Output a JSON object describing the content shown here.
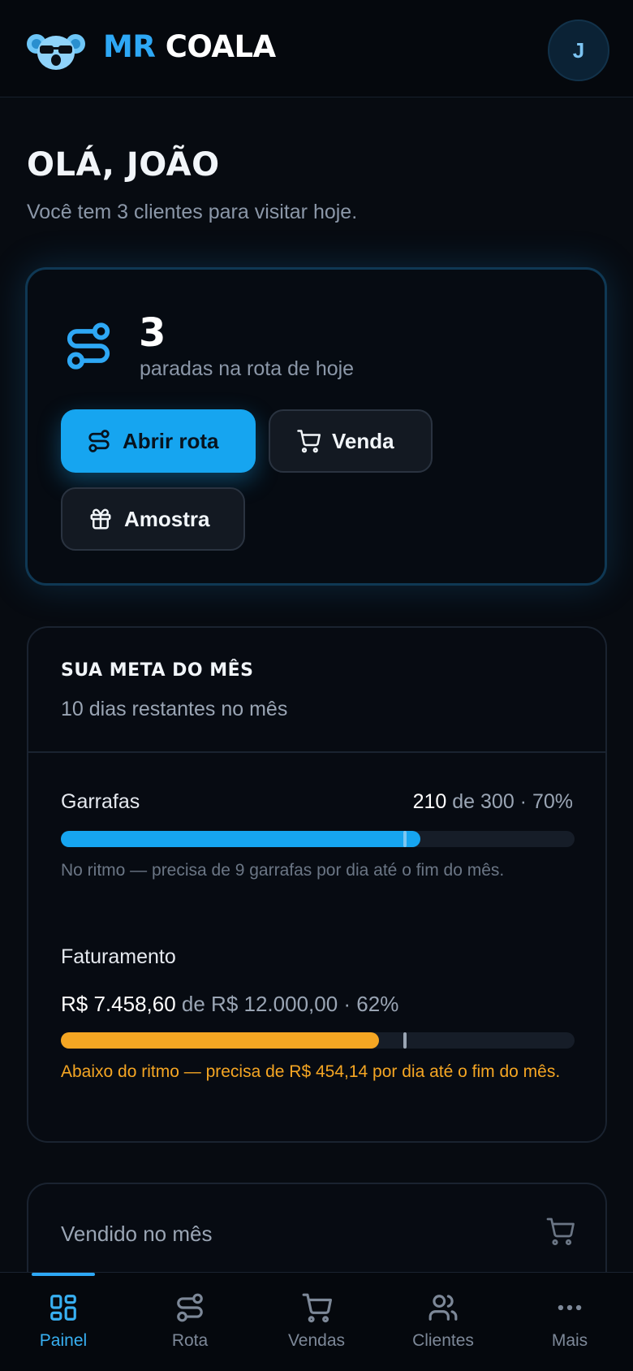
{
  "header": {
    "brand_part1": "MR",
    "brand_part2": "COALA",
    "avatar_initial": "J",
    "logo_icon": "koala-logo-icon"
  },
  "greeting": {
    "title": "OLÁ, JOÃO",
    "subtitle": "Você tem 3 clientes para visitar hoje."
  },
  "route_card": {
    "icon": "route-icon",
    "count": "3",
    "count_label": "paradas na rota de hoje",
    "buttons": {
      "open_route": "Abrir rota",
      "sale": "Venda",
      "sample": "Amostra"
    }
  },
  "goal_card": {
    "title": "SUA META DO MÊS",
    "subtitle": "10 dias restantes no mês",
    "bottles": {
      "label": "Garrafas",
      "current": "210",
      "of_total": " de 300 · 70%",
      "progress": 0.7,
      "expected_pace": 0.67,
      "note": "No ritmo — precisa de 9 garrafas por dia até o fim do mês."
    },
    "revenue": {
      "label": "Faturamento",
      "current": "R$ 7.458,60",
      "of_total": " de R$ 12.000,00 · 62%",
      "progress": 0.62,
      "expected_pace": 0.67,
      "note": "Abaixo do ritmo — precisa de R$ 454,14 por dia até o fim do mês."
    }
  },
  "sold_card": {
    "label": "Vendido no mês",
    "icon": "cart-icon"
  },
  "colors": {
    "accent": "#16a5f0",
    "warning": "#f5a623",
    "background": "#070b11"
  },
  "bottom_nav": {
    "items": [
      {
        "label": "Painel",
        "icon": "grid-icon"
      },
      {
        "label": "Rota",
        "icon": "route-icon"
      },
      {
        "label": "Vendas",
        "icon": "cart-icon"
      },
      {
        "label": "Clientes",
        "icon": "users-icon"
      },
      {
        "label": "Mais",
        "icon": "more-icon"
      }
    ],
    "active": "Painel"
  }
}
